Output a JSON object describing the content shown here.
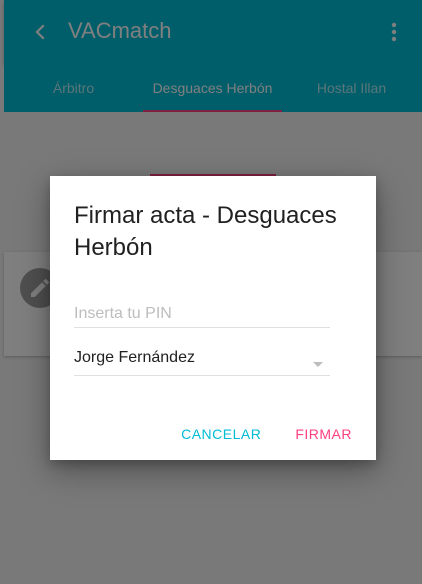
{
  "appbar": {
    "title": "VACmatch",
    "back_icon": "chevron-left-icon",
    "menu_icon": "more-vert-icon"
  },
  "tabs": [
    {
      "label": "Árbitro",
      "active": false
    },
    {
      "label": "Desguaces Herbón",
      "active": true
    },
    {
      "label": "Hostal Illan",
      "active": false
    }
  ],
  "card": {
    "avatar_icon": "edit-icon"
  },
  "dialog": {
    "title": "Firmar acta - Desguaces Herbón",
    "pin_placeholder": "Inserta tu PIN",
    "pin_value": "",
    "selected_person": "Jorge Fernández",
    "cancel_label": "CANCELAR",
    "sign_label": "FIRMAR"
  },
  "colors": {
    "primary": "#00bcd4",
    "accent": "#ff4081"
  }
}
